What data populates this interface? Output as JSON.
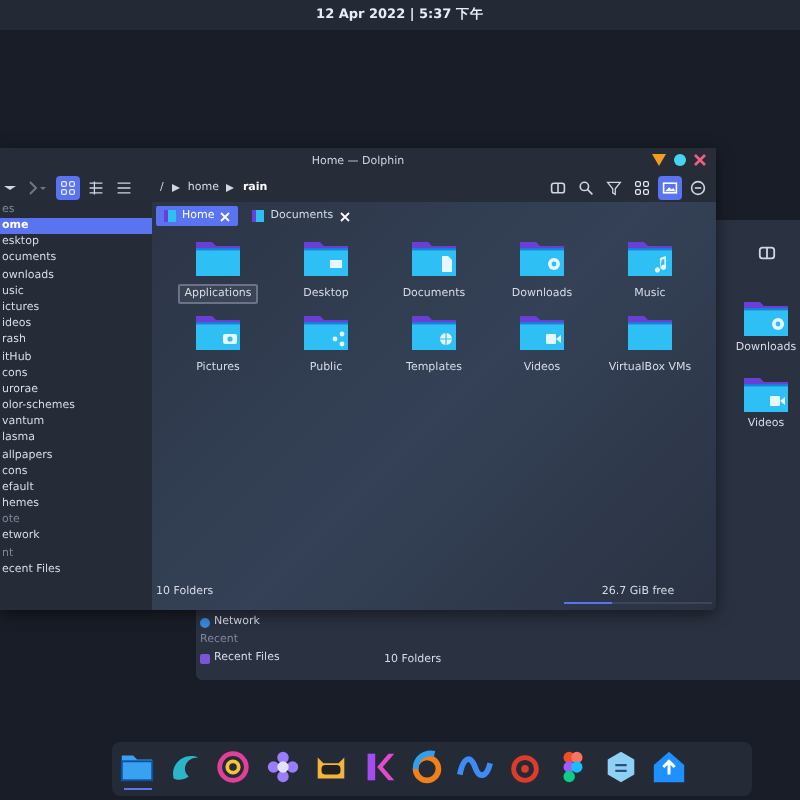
{
  "top_bar": {
    "clock": "12 Apr 2022 | 5:37 下午"
  },
  "back_window": {
    "folders": [
      {
        "label": "Downloads",
        "kind": "download"
      },
      {
        "label": "Videos",
        "kind": "video"
      }
    ],
    "sidebar": [
      {
        "label": "Network",
        "kind": "network"
      },
      {
        "label": "Recent",
        "kind": "section"
      },
      {
        "label": "Recent Files",
        "kind": "recent"
      }
    ],
    "status": "10 Folders"
  },
  "window": {
    "title": "Home — Dolphin",
    "view_modes": [
      {
        "kind": "icons",
        "selected": true
      },
      {
        "kind": "compact",
        "selected": false
      },
      {
        "kind": "details",
        "selected": false
      }
    ],
    "breadcrumb": [
      "/",
      "home",
      "rain"
    ],
    "tools": [
      {
        "kind": "split",
        "selected": false
      },
      {
        "kind": "search",
        "selected": false
      },
      {
        "kind": "filter",
        "selected": false
      },
      {
        "kind": "grid",
        "selected": false
      },
      {
        "kind": "preview",
        "selected": true
      },
      {
        "kind": "menu",
        "selected": false
      }
    ],
    "tabs": [
      {
        "label": "Home",
        "selected": true
      },
      {
        "label": "Documents",
        "selected": false
      }
    ],
    "sidebar": [
      {
        "label": "es",
        "kind": "section"
      },
      {
        "label": "ome",
        "kind": "item",
        "selected": true
      },
      {
        "label": "esktop",
        "kind": "item",
        "selected": false
      },
      {
        "label": "ocuments",
        "kind": "item",
        "selected": false
      },
      {
        "label": "ownloads",
        "kind": "item",
        "selected": false
      },
      {
        "label": "usic",
        "kind": "item",
        "selected": false
      },
      {
        "label": "ictures",
        "kind": "item",
        "selected": false
      },
      {
        "label": "ideos",
        "kind": "item",
        "selected": false
      },
      {
        "label": "rash",
        "kind": "item",
        "selected": false
      },
      {
        "label": "itHub",
        "kind": "item",
        "selected": false
      },
      {
        "label": "cons",
        "kind": "item",
        "selected": false
      },
      {
        "label": "urorae",
        "kind": "item",
        "selected": false
      },
      {
        "label": "olor-schemes",
        "kind": "item",
        "selected": false
      },
      {
        "label": "vantum",
        "kind": "item",
        "selected": false
      },
      {
        "label": "lasma",
        "kind": "item",
        "selected": false
      },
      {
        "label": "allpapers",
        "kind": "item",
        "selected": false
      },
      {
        "label": "cons",
        "kind": "item",
        "selected": false
      },
      {
        "label": "efault",
        "kind": "item",
        "selected": false
      },
      {
        "label": "hemes",
        "kind": "item",
        "selected": false
      },
      {
        "label": "ote",
        "kind": "section"
      },
      {
        "label": "etwork",
        "kind": "item",
        "selected": false
      },
      {
        "label": "nt",
        "kind": "section"
      },
      {
        "label": "ecent Files",
        "kind": "item",
        "selected": false
      }
    ],
    "folders": [
      {
        "label": "Applications",
        "kind": "plain",
        "selected": true
      },
      {
        "label": "Desktop",
        "kind": "desktop",
        "selected": false
      },
      {
        "label": "Documents",
        "kind": "document",
        "selected": false
      },
      {
        "label": "Downloads",
        "kind": "download",
        "selected": false
      },
      {
        "label": "Music",
        "kind": "music",
        "selected": false
      },
      {
        "label": "Pictures",
        "kind": "camera",
        "selected": false
      },
      {
        "label": "Public",
        "kind": "share",
        "selected": false
      },
      {
        "label": "Templates",
        "kind": "template",
        "selected": false
      },
      {
        "label": "Videos",
        "kind": "video",
        "selected": false
      },
      {
        "label": "VirtualBox VMs",
        "kind": "plain",
        "selected": false
      }
    ],
    "status": "10 Folders",
    "free": "26.7 GiB free",
    "level": 0.32
  },
  "dock": [
    {
      "kind": "files",
      "active": true
    },
    {
      "kind": "swirl",
      "active": false
    },
    {
      "kind": "ring",
      "active": false
    },
    {
      "kind": "flower",
      "active": false
    },
    {
      "kind": "cat",
      "active": false
    },
    {
      "kind": "kbar",
      "active": false
    },
    {
      "kind": "hook",
      "active": false
    },
    {
      "kind": "wave",
      "active": false
    },
    {
      "kind": "spiral",
      "active": false
    },
    {
      "kind": "pads",
      "active": false
    },
    {
      "kind": "hex",
      "active": false
    },
    {
      "kind": "upload",
      "active": false
    }
  ]
}
